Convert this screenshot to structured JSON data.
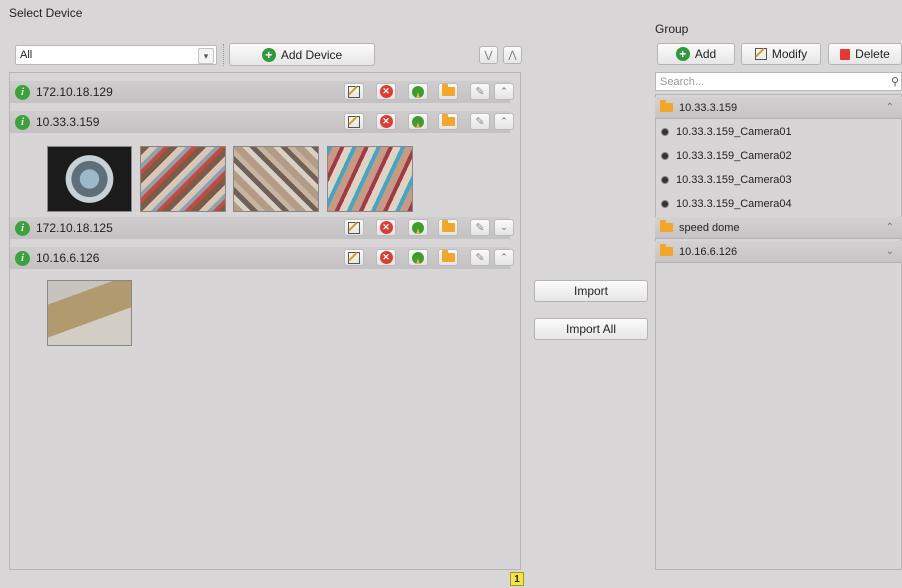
{
  "left": {
    "title": "Select Device",
    "filter_value": "All",
    "add_device_label": "Add Device",
    "devices": [
      {
        "ip": "172.10.18.129",
        "expanded": false
      },
      {
        "ip": "10.33.3.159",
        "expanded": true,
        "channels": 4
      },
      {
        "ip": "172.10.18.125",
        "expanded": false
      },
      {
        "ip": "10.16.6.126",
        "expanded": true,
        "channels": 1
      }
    ]
  },
  "middle": {
    "import_label": "Import",
    "import_all_label": "Import All"
  },
  "right": {
    "title": "Group",
    "add_label": "Add",
    "modify_label": "Modify",
    "delete_label": "Delete",
    "search_placeholder": "Search...",
    "groups": [
      {
        "name": "10.33.3.159",
        "expanded": true,
        "cameras": [
          "10.33.3.159_Camera01",
          "10.33.3.159_Camera02",
          "10.33.3.159_Camera03",
          "10.33.3.159_Camera04"
        ]
      },
      {
        "name": "speed dome",
        "expanded": true,
        "cameras": []
      },
      {
        "name": "10.16.6.126",
        "expanded": false,
        "cameras": []
      }
    ]
  },
  "footer": {
    "page": "1"
  },
  "colors": {
    "panel_bg": "#d7d5d5",
    "row_bg": "#c9c7c7",
    "accent_green": "#2f9a3b",
    "folder": "#f2a72a",
    "delete_red": "#e23a2e"
  }
}
